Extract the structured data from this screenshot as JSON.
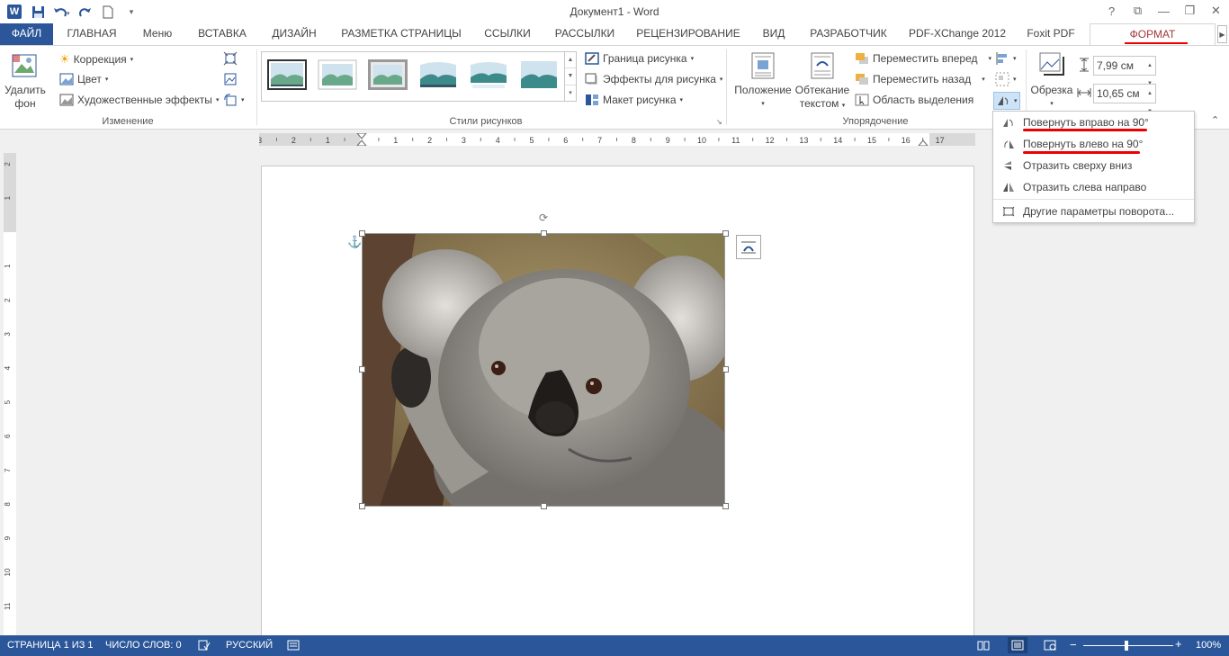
{
  "window": {
    "title": "Документ1 - Word",
    "controls": [
      "?",
      "⧉",
      "—",
      "❐",
      "✕"
    ]
  },
  "qat": {
    "app_icon": "W"
  },
  "tabs": {
    "file": "ФАЙЛ",
    "items": [
      "ГЛАВНАЯ",
      "Меню",
      "ВСТАВКА",
      "ДИЗАЙН",
      "РАЗМЕТКА СТРАНИЦЫ",
      "ССЫЛКИ",
      "РАССЫЛКИ",
      "РЕЦЕНЗИРОВАНИЕ",
      "ВИД",
      "РАЗРАБОТЧИК",
      "PDF-XChange 2012",
      "Foxit PDF"
    ],
    "active": "ФОРМАТ"
  },
  "ribbon": {
    "adjust": {
      "remove_bg_line1": "Удалить",
      "remove_bg_line2": "фон",
      "correction": "Коррекция",
      "color": "Цвет",
      "artistic": "Художественные эффекты",
      "label": "Изменение"
    },
    "styles": {
      "border": "Граница рисунка",
      "effects": "Эффекты для рисунка",
      "layout": "Макет рисунка",
      "label": "Стили рисунков"
    },
    "arrange": {
      "position": "Положение",
      "wrap_line1": "Обтекание",
      "wrap_line2": "текстом",
      "bring_forward": "Переместить вперед",
      "send_backward": "Переместить назад",
      "selection_pane": "Область выделения",
      "label": "Упорядочение"
    },
    "size": {
      "crop": "Обрезка",
      "height": "7,99 см",
      "width": "10,65 см"
    }
  },
  "rotate_menu": {
    "items": [
      "Повернуть вправо на 90°",
      "Повернуть влево на 90°",
      "Отразить сверху вниз",
      "Отразить слева направо",
      "Другие параметры поворота..."
    ]
  },
  "ruler": {
    "h_labels": [
      "3",
      "2",
      "1",
      "1",
      "2",
      "3",
      "4",
      "5",
      "6",
      "7",
      "8",
      "9",
      "10",
      "11",
      "12",
      "13",
      "14",
      "15",
      "16",
      "17"
    ],
    "v_labels": [
      "2",
      "1",
      "1",
      "2",
      "3",
      "4",
      "5",
      "6",
      "7",
      "8",
      "9",
      "10",
      "11"
    ]
  },
  "status": {
    "page": "СТРАНИЦА 1 ИЗ 1",
    "words": "ЧИСЛО СЛОВ: 0",
    "lang": "РУССКИЙ",
    "zoom": "100%"
  },
  "colors": {
    "accent": "#2b579a",
    "format_tab": "#a4373a",
    "annotation": "#e00000"
  }
}
